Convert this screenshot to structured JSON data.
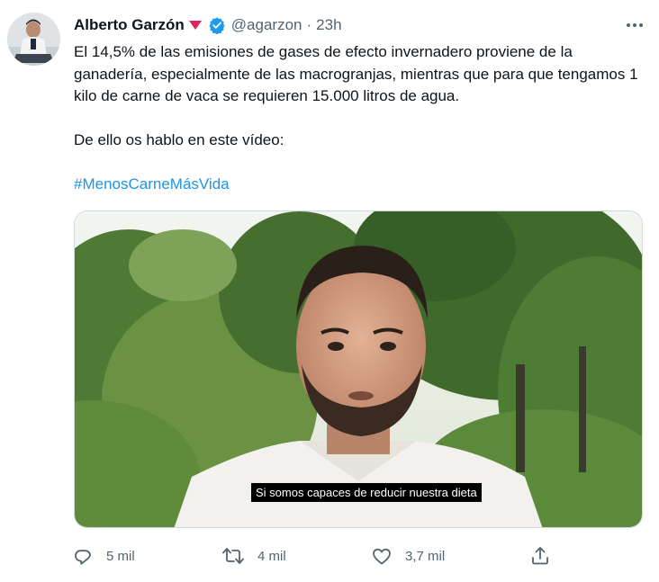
{
  "tweet": {
    "author_name": "Alberto Garzón",
    "handle": "@agarzon",
    "separator": "·",
    "time": "23h",
    "text_paragraphs": [
      "El 14,5% de las emisiones de gases de efecto invernadero proviene de la ganadería, especialmente de las macrogranjas, mientras que para que tengamos 1 kilo de carne de vaca se requieren 15.000 litros de agua.",
      "De ello os hablo en este vídeo:"
    ],
    "hashtag": "#MenosCarneMásVida",
    "video_subtitle": "Si somos capaces de reducir nuestra dieta"
  },
  "actions": {
    "reply_count": "5 mil",
    "retweet_count": "4 mil",
    "like_count": "3,7 mil"
  },
  "icons": [
    "rose-icon",
    "verified-badge-icon",
    "more-options-icon",
    "reply-icon",
    "retweet-icon",
    "like-icon",
    "share-icon"
  ],
  "colors": {
    "verified": "#1d9bf0",
    "hashtag": "#1b95e0",
    "rose": "#e0245e",
    "secondary_text": "#536471"
  }
}
